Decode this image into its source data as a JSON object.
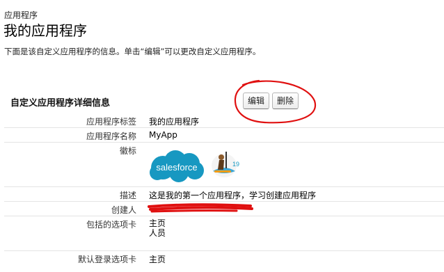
{
  "header": {
    "breadcrumb": "应用程序",
    "title": "我的应用程序",
    "description": "下面是该自定义应用程序的信息。单击“编辑”可以更改自定义应用程序。"
  },
  "section": {
    "title": "自定义应用程序详细信息",
    "edit_label": "编辑",
    "delete_label": "删除"
  },
  "fields": {
    "app_label": {
      "label": "应用程序标签",
      "value": "我的应用程序"
    },
    "app_name": {
      "label": "应用程序名称",
      "value": "MyApp"
    },
    "logo": {
      "label": "徽标",
      "cloud_text": "salesforce",
      "mascot_badge": "19"
    },
    "description": {
      "label": "描述",
      "value": "这是我的第一个应用程序，学习创建应用程序"
    },
    "creator": {
      "label": "创建人",
      "value": ""
    },
    "tabs": {
      "label": "包括的选项卡",
      "values": [
        "主页",
        "人员"
      ]
    },
    "default_tab": {
      "label": "默认登录选项卡",
      "value": "主页"
    }
  },
  "colors": {
    "brand_blue": "#1798c1",
    "annotation_red": "#e01010"
  }
}
